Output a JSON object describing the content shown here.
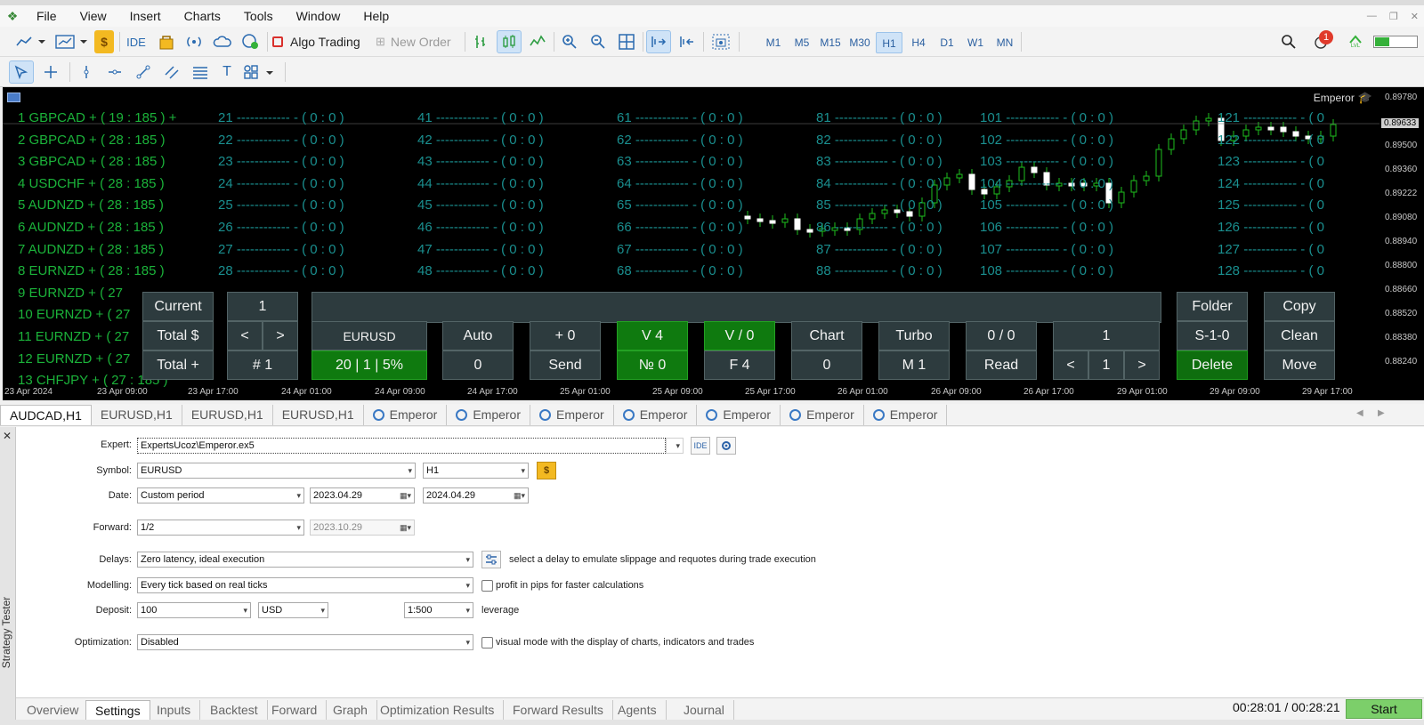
{
  "window": {
    "title_partial": "",
    "controls": [
      "minimize-icon",
      "restore-icon",
      "close-icon"
    ]
  },
  "menu": {
    "items": [
      "File",
      "View",
      "Insert",
      "Charts",
      "Tools",
      "Window",
      "Help"
    ]
  },
  "toolbar": {
    "ide": "IDE",
    "algo_trading": "Algo Trading",
    "new_order": "New Order",
    "timeframes": [
      "M1",
      "M5",
      "M15",
      "M30",
      "H1",
      "H4",
      "D1",
      "W1",
      "MN"
    ],
    "active_timeframe": "H1",
    "notification_count": "1",
    "lvl": "LVL",
    "colors": {
      "accent": "#2a6ab0",
      "active_tf_bg": "#cfe3f7",
      "algo_red": "#d9302c",
      "badge_red": "#e03a2b",
      "green": "#35b13a"
    }
  },
  "chart": {
    "expert_label": "Emperor",
    "symbol_rows": [
      "1 GBPCAD + ( 19 : 185 ) +",
      "2 GBPCAD + ( 28 : 185 )",
      "3 GBPCAD + ( 28 : 185 )",
      "4 USDCHF + ( 28 : 185 )",
      "5 AUDNZD + ( 28 : 185 )",
      "6 AUDNZD + ( 28 : 185 )",
      "7 AUDNZD + ( 28 : 185 )",
      "8 EURNZD + ( 28 : 185 )",
      "9 EURNZD + ( 27",
      "10 EURNZD + ( 27",
      "11 EURNZD + ( 27",
      "12 EURNZD + ( 27",
      "13 CHFJPY + ( 27 : 185 )"
    ],
    "cols": [
      {
        "cells": [
          "21 ------------ - ( 0 : 0 )",
          "22 ------------ - ( 0 : 0 )",
          "23 ------------ - ( 0 : 0 )",
          "24 ------------ - ( 0 : 0 )",
          "25 ------------ - ( 0 : 0 )",
          "26 ------------ - ( 0 : 0 )",
          "27 ------------ - ( 0 : 0 )",
          "28 ------------ - ( 0 : 0 )"
        ]
      },
      {
        "cells": [
          "41 ------------ - ( 0 : 0 )",
          "42 ------------ - ( 0 : 0 )",
          "43 ------------ - ( 0 : 0 )",
          "44 ------------ - ( 0 : 0 )",
          "45 ------------ - ( 0 : 0 )",
          "46 ------------ - ( 0 : 0 )",
          "47 ------------ - ( 0 : 0 )",
          "48 ------------ - ( 0 : 0 )"
        ]
      },
      {
        "cells": [
          "61 ------------ - ( 0 : 0 )",
          "62 ------------ - ( 0 : 0 )",
          "63 ------------ - ( 0 : 0 )",
          "64 ------------ - ( 0 : 0 )",
          "65 ------------ - ( 0 : 0 )",
          "66 ------------ - ( 0 : 0 )",
          "67 ------------ - ( 0 : 0 )",
          "68 ------------ - ( 0 : 0 )"
        ]
      },
      {
        "cells": [
          "81 ------------ - ( 0 : 0 )",
          "82 ------------ - ( 0 : 0 )",
          "83 ------------ - ( 0 : 0 )",
          "84 ------------ - ( 0 : 0 )",
          "85 ------------ - ( 0 : 0 )",
          "86 ------------ - ( 0 : 0 )",
          "87 ------------ - ( 0 : 0 )",
          "88 ------------ - ( 0 : 0 )"
        ]
      },
      {
        "cells": [
          "101 ------------ - ( 0 : 0 )",
          "102 ------------ - ( 0 : 0 )",
          "103 ------------ - ( 0 : 0 )",
          "104 ------------ - ( 0 : 0 )",
          "105 ------------ - ( 0 : 0 )",
          "106 ------------ - ( 0 : 0 )",
          "107 ------------ - ( 0 : 0 )",
          "108 ------------ - ( 0 : 0 )"
        ]
      },
      {
        "cells": [
          "121 ------------ - ( 0",
          "122 ------------ - ( 0",
          "123 ------------ - ( 0",
          "124 ------------ - ( 0",
          "125 ------------ - ( 0",
          "126 ------------ - ( 0",
          "127 ------------ - ( 0",
          "128 ------------ - ( 0"
        ]
      }
    ],
    "prices": [
      "0.89780",
      "0.89633",
      "0.89500",
      "0.89360",
      "0.89222",
      "0.89080",
      "0.88940",
      "0.88800",
      "0.88660",
      "0.88520",
      "0.88380",
      "0.88240"
    ],
    "current_price": "0.89633",
    "times": [
      "23 Apr 2024",
      "23 Apr 09:00",
      "23 Apr 17:00",
      "24 Apr 01:00",
      "24 Apr 09:00",
      "24 Apr 17:00",
      "25 Apr 01:00",
      "25 Apr 09:00",
      "25 Apr 17:00",
      "26 Apr 01:00",
      "26 Apr 09:00",
      "26 Apr 17:00",
      "29 Apr 01:00",
      "29 Apr 09:00",
      "29 Apr 17:00"
    ],
    "controls": {
      "current": "Current",
      "one_a": "1",
      "total_dollar": "Total $",
      "lt": "<",
      "gt": ">",
      "total_plus": "Total +",
      "hash1": "# 1",
      "eurusd": "EURUSD",
      "lots": "20 | 1 | 5%",
      "auto": "Auto",
      "zero_a": "0",
      "plus0": "+ 0",
      "send": "Send",
      "v4": "V 4",
      "no0": "№ 0",
      "v0": "V / 0",
      "f4": "F 4",
      "chart": "Chart",
      "zero_b": "0",
      "turbo": "Turbo",
      "m1": "M 1",
      "ratio": "0 / 0",
      "read": "Read",
      "one_b": "1",
      "lt2": "<",
      "one_c": "1",
      "gt2": ">",
      "folder": "Folder",
      "copy": "Copy",
      "s10": "S-1-0",
      "clean": "Clean",
      "delete": "Delete",
      "move": "Move"
    }
  },
  "tabs": [
    "AUDCAD,H1",
    "EURUSD,H1",
    "EURUSD,H1",
    "EURUSD,H1",
    "Emperor",
    "Emperor",
    "Emperor",
    "Emperor",
    "Emperor",
    "Emperor",
    "Emperor"
  ],
  "tester": {
    "sidebar_label": "Strategy Tester",
    "expert_label": "Expert:",
    "expert": "ExpertsUcoz\\Emperor.ex5",
    "ide": "IDE",
    "symbol_label": "Symbol:",
    "symbol": "EURUSD",
    "period": "H1",
    "date_label": "Date:",
    "date_mode": "Custom period",
    "date_from": "2023.04.29",
    "date_to": "2024.04.29",
    "forward_label": "Forward:",
    "forward": "1/2",
    "forward_date": "2023.10.29",
    "delays_label": "Delays:",
    "delays": "Zero latency, ideal execution",
    "delays_note": "select a delay to emulate slippage and requotes during trade execution",
    "modelling_label": "Modelling:",
    "modelling": "Every tick based on real ticks",
    "pips_note": "profit in pips for faster calculations",
    "deposit_label": "Deposit:",
    "deposit": "100",
    "currency": "USD",
    "leverage": "1:500",
    "leverage_note": "leverage",
    "optimization_label": "Optimization:",
    "optimization": "Disabled",
    "visual_note": "visual mode with the display of charts, indicators and trades"
  },
  "bottom_tabs": [
    "Overview",
    "Settings",
    "Inputs",
    "Backtest",
    "Forward",
    "Graph",
    "Optimization Results",
    "Forward Results",
    "Agents",
    "Journal"
  ],
  "active_bottom_tab": "Settings",
  "elapsed": "00:28:01 / 00:28:21",
  "start": "Start"
}
